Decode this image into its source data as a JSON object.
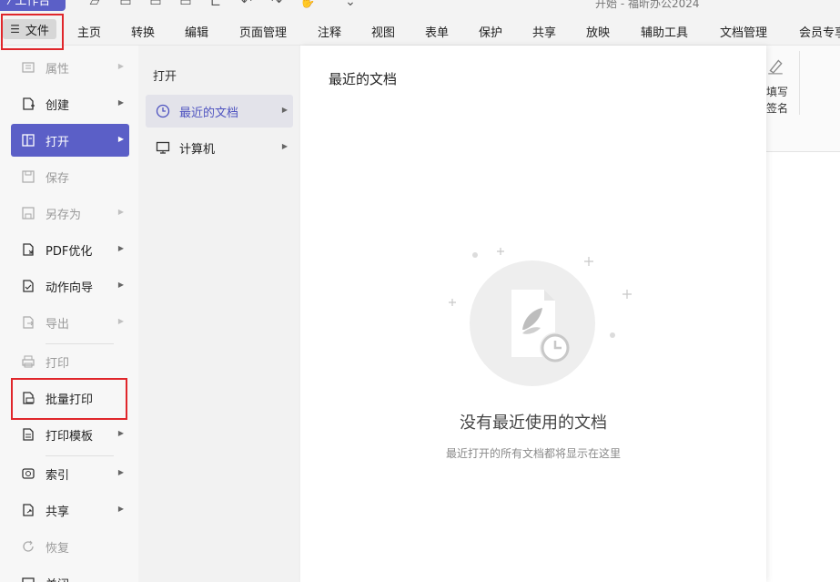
{
  "colors": {
    "accent": "#5b5fc7",
    "highlight": "#e0262b"
  },
  "topbar": {
    "workbench_label": "工作台",
    "window_title": "开始 - 福昕办公2024"
  },
  "menubar": {
    "file_label": "文件",
    "items": [
      "主页",
      "转换",
      "编辑",
      "页面管理",
      "注释",
      "视图",
      "表单",
      "保护",
      "共享",
      "放映",
      "辅助工具",
      "文档管理",
      "会员专享"
    ]
  },
  "ribbon": {
    "label_1": "填写",
    "label_2": "签名"
  },
  "left_menu": {
    "items": [
      {
        "label": "属性",
        "icon": "properties-icon",
        "disabled": true,
        "arrow": true
      },
      {
        "label": "创建",
        "icon": "create-icon",
        "disabled": false,
        "arrow": true
      },
      {
        "label": "打开",
        "icon": "open-icon",
        "disabled": false,
        "arrow": true,
        "active": true
      },
      {
        "label": "保存",
        "icon": "save-icon",
        "disabled": true,
        "arrow": false
      },
      {
        "label": "另存为",
        "icon": "save-as-icon",
        "disabled": true,
        "arrow": true
      },
      {
        "label": "PDF优化",
        "icon": "pdf-optimize-icon",
        "disabled": false,
        "arrow": true
      },
      {
        "label": "动作向导",
        "icon": "action-wizard-icon",
        "disabled": false,
        "arrow": true
      },
      {
        "label": "导出",
        "icon": "export-icon",
        "disabled": true,
        "arrow": true
      },
      {
        "label": "打印",
        "icon": "print-icon",
        "disabled": true,
        "arrow": false
      },
      {
        "label": "批量打印",
        "icon": "batch-print-icon",
        "disabled": false,
        "arrow": false
      },
      {
        "label": "打印模板",
        "icon": "print-template-icon",
        "disabled": false,
        "arrow": true
      },
      {
        "label": "索引",
        "icon": "index-icon",
        "disabled": false,
        "arrow": true
      },
      {
        "label": "共享",
        "icon": "share-icon",
        "disabled": false,
        "arrow": true
      },
      {
        "label": "恢复",
        "icon": "restore-icon",
        "disabled": true,
        "arrow": false
      },
      {
        "label": "关闭",
        "icon": "close-doc-icon",
        "disabled": false,
        "arrow": false
      }
    ]
  },
  "open_submenu": {
    "title": "打开",
    "items": [
      {
        "label": "最近的文档",
        "icon": "clock-icon",
        "selected": true
      },
      {
        "label": "计算机",
        "icon": "computer-icon",
        "selected": false
      }
    ]
  },
  "main": {
    "title": "最近的文档",
    "empty_title": "没有最近使用的文档",
    "empty_subtitle": "最近打开的所有文档都将显示在这里"
  }
}
